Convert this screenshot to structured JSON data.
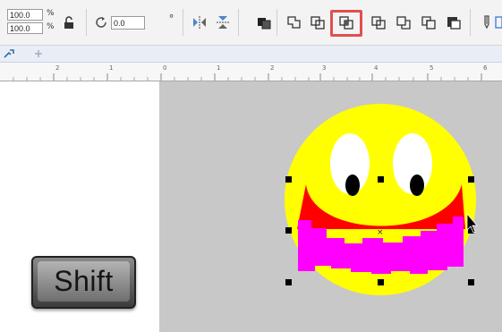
{
  "toolbar": {
    "scale_width": "100.0",
    "scale_height": "100.0",
    "percent_symbol": "%",
    "rotation_angle": "0.0",
    "degree_symbol": "°",
    "highlighted_tool": "intersect-shaping-icon",
    "highlight_color": "#e0504d",
    "icons": [
      "lock-ratio-icon",
      "rotate-icon",
      "mirror-horizontal-icon",
      "mirror-vertical-icon",
      "combine-icon",
      "weld-icon",
      "trim-icon",
      "intersect-icon",
      "simplify-icon",
      "front-minus-back-icon",
      "back-minus-front-icon",
      "boundary-icon",
      "pen-icon"
    ]
  },
  "tabs": {
    "document_tab_icon": "document-tab-icon",
    "add_tab_icon": "add-tab-icon"
  },
  "ruler": {
    "labels": [
      "2",
      "1",
      "0",
      "1",
      "2",
      "3",
      "4",
      "5",
      "6"
    ]
  },
  "canvas": {
    "page_color": "#ffffff",
    "desktop_color": "#c8c8c8",
    "smiley_face_color": "#ffff00",
    "mouth_color": "#ff0000",
    "selected_shape_color": "#ff00ff",
    "eye_white_color": "#ffffff",
    "pupil_color": "#000000"
  },
  "keyboard": {
    "shift_key_label": "Shift"
  }
}
